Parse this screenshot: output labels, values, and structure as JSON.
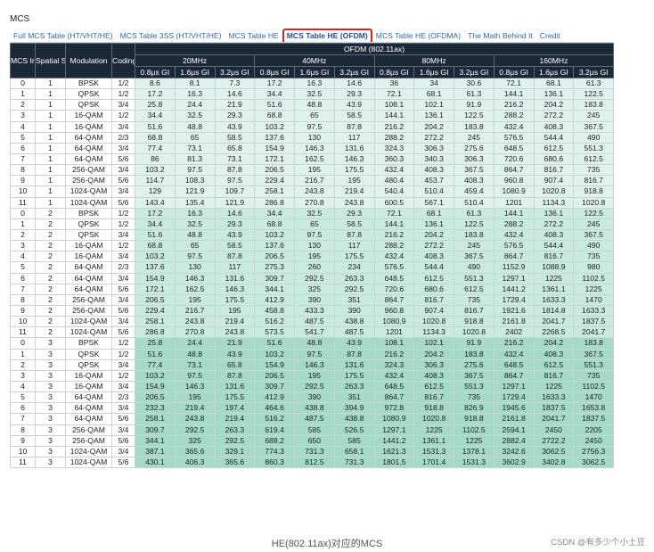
{
  "page": {
    "heading": "MCS",
    "caption": "HE(802.11ax)对应的MCS",
    "watermark_zhihu": "知乎 @T-Boy",
    "watermark_csdn": "CSDN @有多少个小土豆"
  },
  "tabs": [
    {
      "label": "Full MCS Table (HT/VHT/HE)",
      "active": false
    },
    {
      "label": "MCS Table 3SS (HT/VHT/HE)",
      "active": false
    },
    {
      "label": "MCS Table HE",
      "active": false
    },
    {
      "label": "MCS Table HE (OFDM)",
      "active": true
    },
    {
      "label": "MCS Table HE (OFDMA)",
      "active": false
    },
    {
      "label": "The Math Behind It",
      "active": false
    },
    {
      "label": "Credit",
      "active": false
    }
  ],
  "colors": {
    "header_bg": "#1b2936",
    "active_tab_border": "#d9241f",
    "link": "#2a6bb3",
    "ss1_bg": "#e3f3ee",
    "ss2_bg": "#cdebe2",
    "ss3_bg": "#a9dccb"
  },
  "table": {
    "super_header": "OFDM (802.11ax)",
    "col_headers": {
      "mcs_index": "MCS Index",
      "spatial_stream": "Spatial Stream",
      "modulation": "Modulation",
      "coding": "Coding"
    },
    "bandwidths": [
      "20MHz",
      "40MHz",
      "80MHz",
      "160MHz"
    ],
    "guard_intervals": [
      "0.8μs GI",
      "1.6μs GI",
      "3.2μs GI"
    ],
    "rows": [
      [
        "0",
        "1",
        "BPSK",
        "1/2",
        "8.6",
        "8.1",
        "7.3",
        "17.2",
        "16.3",
        "14.6",
        "36",
        "34",
        "30.6",
        "72.1",
        "68.1",
        "61.3"
      ],
      [
        "1",
        "1",
        "QPSK",
        "1/2",
        "17.2",
        "16.3",
        "14.6",
        "34.4",
        "32.5",
        "29.3",
        "72.1",
        "68.1",
        "61.3",
        "144.1",
        "136.1",
        "122.5"
      ],
      [
        "2",
        "1",
        "QPSK",
        "3/4",
        "25.8",
        "24.4",
        "21.9",
        "51.6",
        "48.8",
        "43.9",
        "108.1",
        "102.1",
        "91.9",
        "216.2",
        "204.2",
        "183.8"
      ],
      [
        "3",
        "1",
        "16-QAM",
        "1/2",
        "34.4",
        "32.5",
        "29.3",
        "68.8",
        "65",
        "58.5",
        "144.1",
        "136.1",
        "122.5",
        "288.2",
        "272.2",
        "245"
      ],
      [
        "4",
        "1",
        "16-QAM",
        "3/4",
        "51.6",
        "48.8",
        "43.9",
        "103.2",
        "97.5",
        "87.8",
        "216.2",
        "204.2",
        "183.8",
        "432.4",
        "408.3",
        "367.5"
      ],
      [
        "5",
        "1",
        "64-QAM",
        "2/3",
        "68.8",
        "65",
        "58.5",
        "137.6",
        "130",
        "117",
        "288.2",
        "272.2",
        "245",
        "576.5",
        "544.4",
        "490"
      ],
      [
        "6",
        "1",
        "64-QAM",
        "3/4",
        "77.4",
        "73.1",
        "65.8",
        "154.9",
        "146.3",
        "131.6",
        "324.3",
        "306.3",
        "275.6",
        "648.5",
        "612.5",
        "551.3"
      ],
      [
        "7",
        "1",
        "64-QAM",
        "5/6",
        "86",
        "81.3",
        "73.1",
        "172.1",
        "162.5",
        "146.3",
        "360.3",
        "340.3",
        "306.3",
        "720.6",
        "680.6",
        "612.5"
      ],
      [
        "8",
        "1",
        "256-QAM",
        "3/4",
        "103.2",
        "97.5",
        "87.8",
        "206.5",
        "195",
        "175.5",
        "432.4",
        "408.3",
        "367.5",
        "864.7",
        "816.7",
        "735"
      ],
      [
        "9",
        "1",
        "256-QAM",
        "5/6",
        "114.7",
        "108.3",
        "97.5",
        "229.4",
        "216.7",
        "195",
        "480.4",
        "453.7",
        "408.3",
        "960.8",
        "907.4",
        "816.7"
      ],
      [
        "10",
        "1",
        "1024-QAM",
        "3/4",
        "129",
        "121.9",
        "109.7",
        "258.1",
        "243.8",
        "219.4",
        "540.4",
        "510.4",
        "459.4",
        "1080.9",
        "1020.8",
        "918.8"
      ],
      [
        "11",
        "1",
        "1024-QAM",
        "5/6",
        "143.4",
        "135.4",
        "121.9",
        "286.8",
        "270.8",
        "243.8",
        "600.5",
        "567.1",
        "510.4",
        "1201",
        "1134.3",
        "1020.8"
      ],
      [
        "0",
        "2",
        "BPSK",
        "1/2",
        "17.2",
        "16.3",
        "14.6",
        "34.4",
        "32.5",
        "29.3",
        "72.1",
        "68.1",
        "61.3",
        "144.1",
        "136.1",
        "122.5"
      ],
      [
        "1",
        "2",
        "QPSK",
        "1/2",
        "34.4",
        "32.5",
        "29.3",
        "68.8",
        "65",
        "58.5",
        "144.1",
        "136.1",
        "122.5",
        "288.2",
        "272.2",
        "245"
      ],
      [
        "2",
        "2",
        "QPSK",
        "3/4",
        "51.6",
        "48.8",
        "43.9",
        "103.2",
        "97.5",
        "87.8",
        "216.2",
        "204.2",
        "183.8",
        "432.4",
        "408.3",
        "367.5"
      ],
      [
        "3",
        "2",
        "16-QAM",
        "1/2",
        "68.8",
        "65",
        "58.5",
        "137.6",
        "130",
        "117",
        "288.2",
        "272.2",
        "245",
        "576.5",
        "544.4",
        "490"
      ],
      [
        "4",
        "2",
        "16-QAM",
        "3/4",
        "103.2",
        "97.5",
        "87.8",
        "206.5",
        "195",
        "175.5",
        "432.4",
        "408.3",
        "367.5",
        "864.7",
        "816.7",
        "735"
      ],
      [
        "5",
        "2",
        "64-QAM",
        "2/3",
        "137.6",
        "130",
        "117",
        "275.3",
        "260",
        "234",
        "576.5",
        "544.4",
        "490",
        "1152.9",
        "1088.9",
        "980"
      ],
      [
        "6",
        "2",
        "64-QAM",
        "3/4",
        "154.9",
        "146.3",
        "131.6",
        "309.7",
        "292.5",
        "263.3",
        "648.5",
        "612.5",
        "551.3",
        "1297.1",
        "1225",
        "1102.5"
      ],
      [
        "7",
        "2",
        "64-QAM",
        "5/6",
        "172.1",
        "162.5",
        "146.3",
        "344.1",
        "325",
        "292.5",
        "720.6",
        "680.6",
        "612.5",
        "1441.2",
        "1361.1",
        "1225"
      ],
      [
        "8",
        "2",
        "256-QAM",
        "3/4",
        "206.5",
        "195",
        "175.5",
        "412.9",
        "390",
        "351",
        "864.7",
        "816.7",
        "735",
        "1729.4",
        "1633.3",
        "1470"
      ],
      [
        "9",
        "2",
        "256-QAM",
        "5/6",
        "229.4",
        "216.7",
        "195",
        "458.8",
        "433.3",
        "390",
        "960.8",
        "907.4",
        "816.7",
        "1921.6",
        "1814.8",
        "1633.3"
      ],
      [
        "10",
        "2",
        "1024-QAM",
        "3/4",
        "258.1",
        "243.8",
        "219.4",
        "516.2",
        "487.5",
        "438.8",
        "1080.9",
        "1020.8",
        "918.8",
        "2161.8",
        "2041.7",
        "1837.5"
      ],
      [
        "11",
        "2",
        "1024-QAM",
        "5/6",
        "286.8",
        "270.8",
        "243.8",
        "573.5",
        "541.7",
        "487.5",
        "1201",
        "1134.3",
        "1020.8",
        "2402",
        "2268.5",
        "2041.7"
      ],
      [
        "0",
        "3",
        "BPSK",
        "1/2",
        "25.8",
        "24.4",
        "21.9",
        "51.6",
        "48.8",
        "43.9",
        "108.1",
        "102.1",
        "91.9",
        "216.2",
        "204.2",
        "183.8"
      ],
      [
        "1",
        "3",
        "QPSK",
        "1/2",
        "51.6",
        "48.8",
        "43.9",
        "103.2",
        "97.5",
        "87.8",
        "216.2",
        "204.2",
        "183.8",
        "432.4",
        "408.3",
        "367.5"
      ],
      [
        "2",
        "3",
        "QPSK",
        "3/4",
        "77.4",
        "73.1",
        "65.8",
        "154.9",
        "146.3",
        "131.6",
        "324.3",
        "306.3",
        "275.6",
        "648.5",
        "612.5",
        "551.3"
      ],
      [
        "3",
        "3",
        "16-QAM",
        "1/2",
        "103.2",
        "97.5",
        "87.8",
        "206.5",
        "195",
        "175.5",
        "432.4",
        "408.3",
        "367.5",
        "864.7",
        "816.7",
        "735"
      ],
      [
        "4",
        "3",
        "16-QAM",
        "3/4",
        "154.9",
        "146.3",
        "131.6",
        "309.7",
        "292.5",
        "263.3",
        "648.5",
        "612.5",
        "551.3",
        "1297.1",
        "1225",
        "1102.5"
      ],
      [
        "5",
        "3",
        "64-QAM",
        "2/3",
        "206.5",
        "195",
        "175.5",
        "412.9",
        "390",
        "351",
        "864.7",
        "816.7",
        "735",
        "1729.4",
        "1633.3",
        "1470"
      ],
      [
        "6",
        "3",
        "64-QAM",
        "3/4",
        "232.3",
        "219.4",
        "197.4",
        "464.6",
        "438.8",
        "394.9",
        "972.8",
        "918.8",
        "826.9",
        "1945.6",
        "1837.5",
        "1653.8"
      ],
      [
        "7",
        "3",
        "64-QAM",
        "5/6",
        "258.1",
        "243.8",
        "219.4",
        "516.2",
        "487.5",
        "438.8",
        "1080.9",
        "1020.8",
        "918.8",
        "2161.8",
        "2041.7",
        "1837.5"
      ],
      [
        "8",
        "3",
        "256-QAM",
        "3/4",
        "309.7",
        "292.5",
        "263.3",
        "619.4",
        "585",
        "526.5",
        "1297.1",
        "1225",
        "1102.5",
        "2594.1",
        "2450",
        "2205"
      ],
      [
        "9",
        "3",
        "256-QAM",
        "5/6",
        "344.1",
        "325",
        "292.5",
        "688.2",
        "650",
        "585",
        "1441.2",
        "1361.1",
        "1225",
        "2882.4",
        "2722.2",
        "2450"
      ],
      [
        "10",
        "3",
        "1024-QAM",
        "3/4",
        "387.1",
        "365.6",
        "329.1",
        "774.3",
        "731.3",
        "658.1",
        "1621.3",
        "1531.3",
        "1378.1",
        "3242.6",
        "3062.5",
        "2756.3"
      ],
      [
        "11",
        "3",
        "1024-QAM",
        "5/6",
        "430.1",
        "406.3",
        "365.6",
        "860.3",
        "812.5",
        "731.3",
        "1801.5",
        "1701.4",
        "1531.3",
        "3602.9",
        "3402.8",
        "3062.5"
      ]
    ]
  }
}
